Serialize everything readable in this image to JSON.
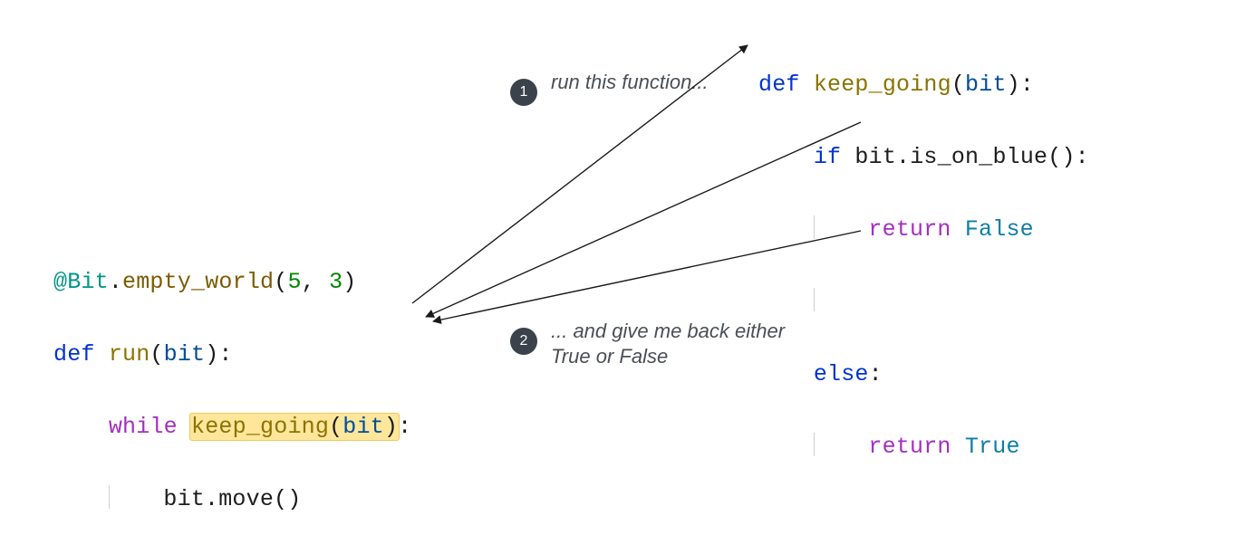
{
  "left_code": {
    "decorator_at": "@",
    "decorator_obj": "Bit",
    "decorator_dot": ".",
    "decorator_fn": "empty_world",
    "decorator_open": "(",
    "arg1": "5",
    "comma": ", ",
    "arg2": "3",
    "decorator_close": ")",
    "def": "def ",
    "fn_name": "run",
    "paren_open": "(",
    "param": "bit",
    "paren_close_colon": "):",
    "while_kw": "while ",
    "call_name": "keep_going",
    "call_open": "(",
    "call_arg": "bit",
    "call_close": ")",
    "colon": ":",
    "body_obj": "bit",
    "body_dot": ".",
    "body_method": "move",
    "body_parens": "()"
  },
  "right_code": {
    "def": "def ",
    "fn_name": "keep_going",
    "paren_open": "(",
    "param": "bit",
    "paren_close_colon": "):",
    "if_kw": "if ",
    "cond_obj": "bit",
    "cond_dot": ".",
    "cond_method": "is_on_blue",
    "cond_parens": "()",
    "cond_colon": ":",
    "return1": "return ",
    "false_val": "False",
    "else_kw": "else",
    "else_colon": ":",
    "return2": "return ",
    "true_val": "True"
  },
  "annotations": {
    "step1_num": "1",
    "step1_text": "run this function...",
    "step2_num": "2",
    "step2_text": "... and give me back either True or False"
  }
}
